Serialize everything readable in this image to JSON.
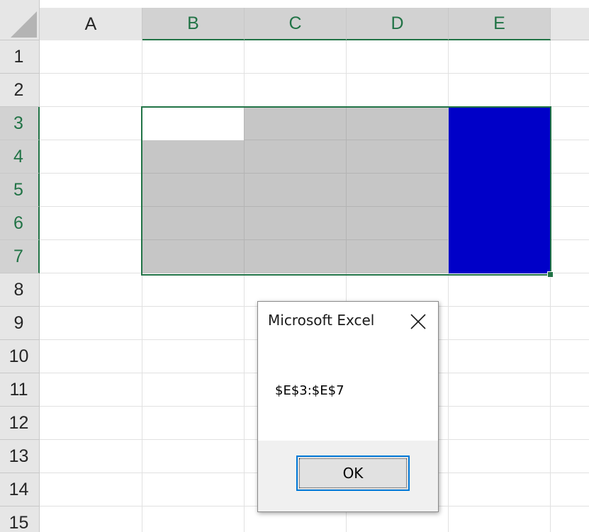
{
  "sheet": {
    "columns": [
      "A",
      "B",
      "C",
      "D",
      "E"
    ],
    "rows": [
      "1",
      "2",
      "3",
      "4",
      "5",
      "6",
      "7",
      "8",
      "9",
      "10",
      "11",
      "12",
      "13",
      "14",
      "15"
    ],
    "selected_columns": [
      "B",
      "C",
      "D",
      "E"
    ],
    "selected_rows": [
      "3",
      "4",
      "5",
      "6",
      "7"
    ],
    "selection_range": "B3:E7",
    "active_cell": "B3",
    "highlighted_range": "E3:E7"
  },
  "colors": {
    "selection_border": "#217346",
    "selection_fill": "#c6c6c6",
    "highlight_fill": "#0000c8"
  },
  "dialog": {
    "title": "Microsoft Excel",
    "close_icon": "close-icon",
    "message": "$E$3:$E$7",
    "ok_label": "OK"
  }
}
